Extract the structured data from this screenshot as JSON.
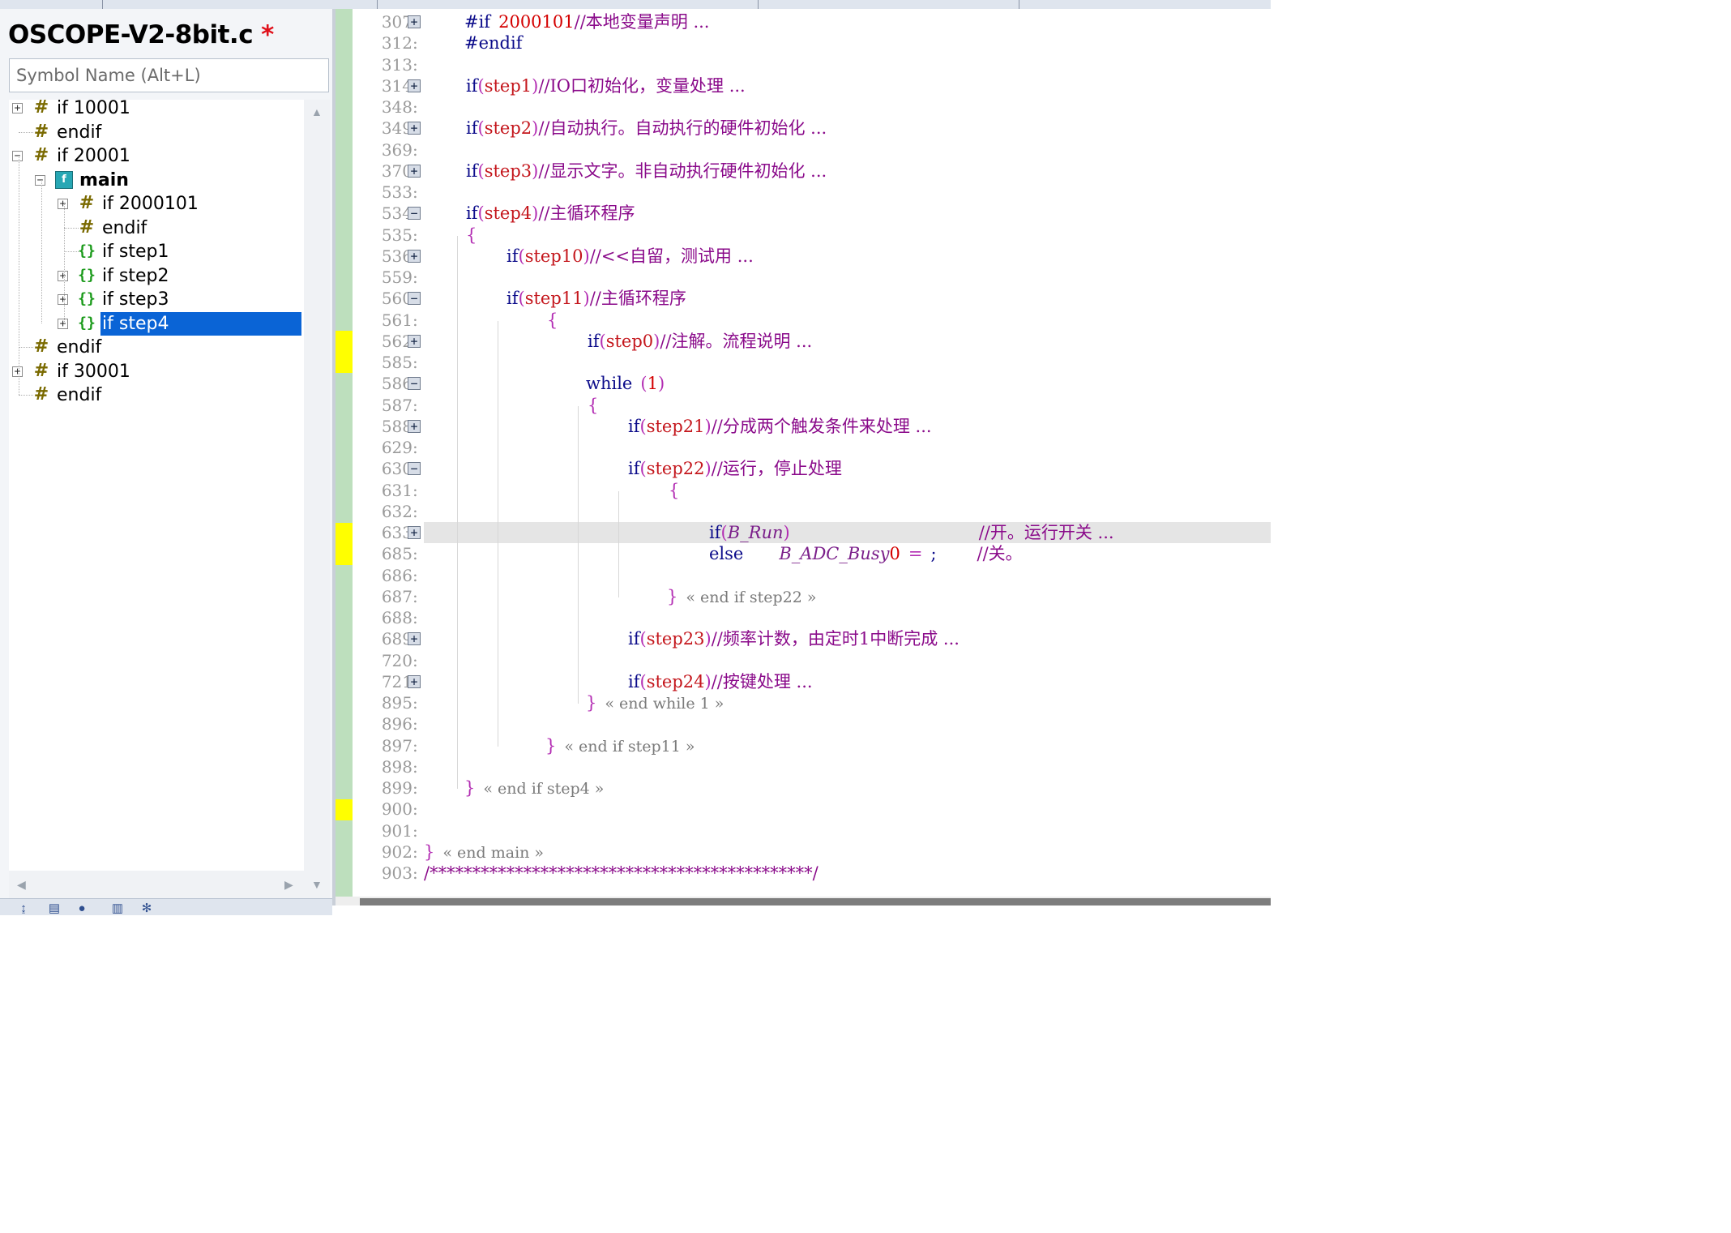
{
  "symbol_panel": {
    "file_title": "OSCOPE-V2-8bit.c",
    "modified_mark": "*",
    "search_placeholder": "Symbol Name (Alt+L)",
    "tree": [
      {
        "label": "if 10001",
        "icon": "preprocessor-icon",
        "expander": "+"
      },
      {
        "label": "endif",
        "icon": "preprocessor-icon"
      },
      {
        "label": "if 20001",
        "icon": "preprocessor-icon",
        "expander": "−"
      },
      {
        "label": "main",
        "icon": "function-icon",
        "expander": "−"
      },
      {
        "label": "if 2000101",
        "icon": "preprocessor-icon",
        "expander": "+"
      },
      {
        "label": "endif",
        "icon": "preprocessor-icon"
      },
      {
        "label": "if step1",
        "icon": "brace-block-icon"
      },
      {
        "label": "if step2",
        "icon": "brace-block-icon",
        "expander": "+"
      },
      {
        "label": "if step3",
        "icon": "brace-block-icon",
        "expander": "+"
      },
      {
        "label": "if step4",
        "icon": "brace-block-icon",
        "expander": "+",
        "selected": true
      },
      {
        "label": "endif",
        "icon": "preprocessor-icon"
      },
      {
        "label": "if 30001",
        "icon": "preprocessor-icon",
        "expander": "+"
      },
      {
        "label": "endif",
        "icon": "preprocessor-icon"
      }
    ]
  },
  "editor": {
    "line_numbers": [
      "307",
      "312",
      "313",
      "314",
      "348",
      "349",
      "369",
      "370",
      "533",
      "534",
      "535",
      "536",
      "559",
      "560",
      "561",
      "562",
      "585",
      "586",
      "587",
      "588",
      "629",
      "630",
      "631",
      "632",
      "633",
      "685",
      "686",
      "687",
      "688",
      "689",
      "720",
      "721",
      "895",
      "896",
      "897",
      "898",
      "899",
      "900",
      "901",
      "902",
      "903"
    ],
    "code": {
      "l307": {
        "kw": "#if",
        "num": "2000101",
        "cm": "//本地变量声明 ..."
      },
      "l312": {
        "kw": "#endif"
      },
      "l314": {
        "kw": "if",
        "op": "(",
        "cond": "step1",
        "cp": ")",
        "cm": "//IO口初始化，变量处理 ..."
      },
      "l349": {
        "kw": "if",
        "op": "(",
        "cond": "step2",
        "cp": ")",
        "cm": "//自动执行。自动执行的硬件初始化 ..."
      },
      "l370": {
        "kw": "if",
        "op": "(",
        "cond": "step3",
        "cp": ")",
        "cm": "//显示文字。非自动执行硬件初始化 ..."
      },
      "l534": {
        "kw": "if",
        "op": "(",
        "cond": "step4",
        "cp": ")",
        "cm": "//主循环程序"
      },
      "l535": {
        "br": "{"
      },
      "l536": {
        "kw": "if",
        "op": "(",
        "cond": "step10",
        "cp": ")",
        "cm": "//<<自留，测试用 ..."
      },
      "l560": {
        "kw": "if",
        "op": "(",
        "cond": "step11",
        "cp": ")",
        "cm": "//主循环程序"
      },
      "l561": {
        "br": "{"
      },
      "l562": {
        "kw": "if",
        "op": "(",
        "cond": "step0",
        "cp": ")",
        "cm": "//注解。流程说明 ..."
      },
      "l586": {
        "kw": "while",
        "op": "(",
        "num": "1",
        "cp": ")"
      },
      "l587": {
        "br": "{"
      },
      "l588": {
        "kw": "if",
        "op": "(",
        "cond": "step21",
        "cp": ")",
        "cm": "//分成两个触发条件来处理 ..."
      },
      "l630": {
        "kw": "if",
        "op": "(",
        "cond": "step22",
        "cp": ")",
        "cm": "//运行，停止处理"
      },
      "l631": {
        "br": "{"
      },
      "l633": {
        "kw": "if",
        "op": "(",
        "var": "B_Run",
        "cp": ")",
        "cm": "//开。运行开关 ..."
      },
      "l685": {
        "kw": "else",
        "var": "B_ADC_Busy",
        "eq": "=",
        "num": "0",
        "semi": ";",
        "cm": "//关。"
      },
      "l687": {
        "br": "}",
        "end": "« end if step22 »"
      },
      "l689": {
        "kw": "if",
        "op": "(",
        "cond": "step23",
        "cp": ")",
        "cm": "//频率计数，由定时1中断完成 ..."
      },
      "l721": {
        "kw": "if",
        "op": "(",
        "cond": "step24",
        "cp": ")",
        "cm": "//按键处理 ..."
      },
      "l895": {
        "br": "}",
        "end": "« end while 1 »"
      },
      "l897": {
        "br": "}",
        "end": "« end if step11 »"
      },
      "l899": {
        "br": "}",
        "end": "« end if step4 »"
      },
      "l902": {
        "br": "}",
        "end": "« end main »"
      },
      "l903": {
        "cm": "/*********************************************/"
      }
    }
  },
  "colors": {
    "keyword": "#0b0b8a",
    "condition": "#c4161c",
    "comment": "#8a0a8a",
    "selection": "#0a64d6",
    "margin_green": "#bddfbd",
    "bookmark_yellow": "#ffff00"
  }
}
